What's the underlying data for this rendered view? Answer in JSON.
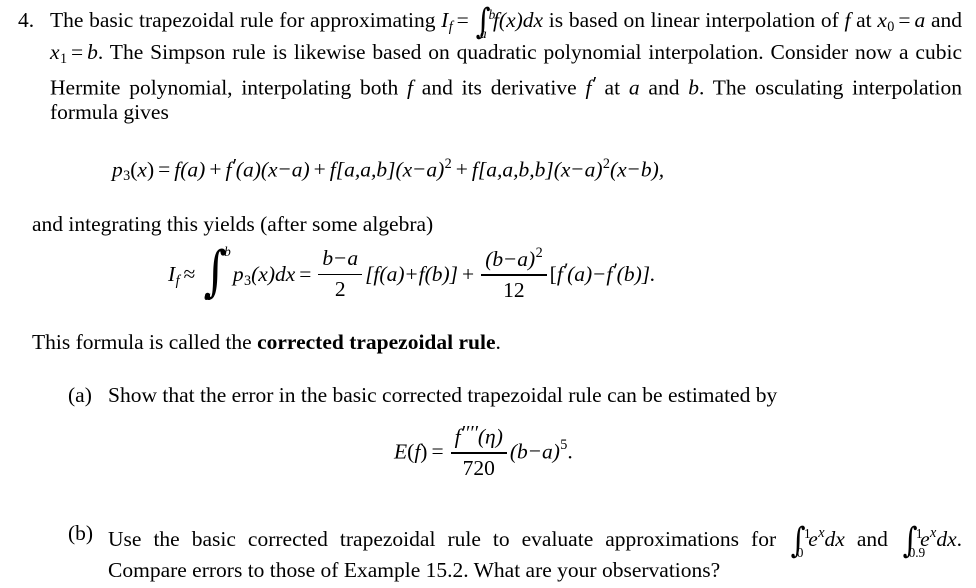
{
  "document": {
    "item_number": "4.",
    "paragraph_1": {
      "t1": "The basic trapezoidal rule for approximating ",
      "sym_I": "I",
      "sym_I_sub": "f",
      "eq": "=",
      "int_lower": "a",
      "int_upper": "b",
      "integrand": "f(x)dx",
      "t2": " is based on linear interpolation of ",
      "sym_f": "f",
      "t3": " at ",
      "x0": "x",
      "x0_sub": "0",
      "eq2": "=",
      "a": "a",
      "t4": " and ",
      "x1": "x",
      "x1_sub": "1",
      "eq3": "=",
      "b": "b",
      "t5": ". The Simpson rule is likewise based on quadratic polynomial interpolation. Consider now a cubic Hermite polynomial, interpolating both ",
      "sym_f2": "f",
      "t6": " and its derivative ",
      "sym_fprime": "f",
      "prime": "′",
      "t7": " at ",
      "a2": "a",
      "t8": " and ",
      "b2": "b",
      "t9": ". The osculating interpolation formula gives"
    },
    "equation_p3": {
      "p": "p",
      "p_sub": "3",
      "open": "(",
      "x": "x",
      "close": ")",
      "eq": "=",
      "f1": "f",
      "arg_a": "(a)",
      "plus1": "+",
      "f2": "f",
      "prime": "′",
      "arg_a2": "(a)(x",
      "minus1": "−",
      "a_close": "a)",
      "plus2": "+",
      "f3": "f",
      "dd1": "[a,a,b](x",
      "minus2": "−",
      "dd1_close": "a)",
      "sup2a": "2",
      "plus3": "+",
      "f4": "f",
      "dd2": "[a,a,b,b](x",
      "minus3": "−",
      "dd2_close": "a)",
      "sup2b": "2",
      "tail_open": "(x",
      "minus4": "−",
      "tail_close": "b),"
    },
    "paragraph_2": "and integrating this yields (after some algebra)",
    "equation_trapezoid": {
      "I": "I",
      "I_sub": "f",
      "approx": "≈",
      "int_lower": "a",
      "int_upper": "b",
      "p3": "p",
      "p3_sub": "3",
      "p3_arg": "(x)dx",
      "eq": "=",
      "frac1_num_b": "b",
      "frac1_num_minus": "−",
      "frac1_num_a": "a",
      "frac1_den": "2",
      "bracket1": "[f(a)",
      "bracket1_plus": "+",
      "bracket1_end": "f(b)]",
      "plus": "+",
      "frac2_num_open": "(b",
      "frac2_num_minus": "−",
      "frac2_num_a": "a)",
      "frac2_num_sup": "2",
      "frac2_den": "12",
      "bracket2_open": "[",
      "bracket2_f1": "f",
      "bracket2_p1": "′",
      "bracket2_a": "(a)",
      "bracket2_minus": "−",
      "bracket2_f2": "f",
      "bracket2_p2": "′",
      "bracket2_b": "(b)]."
    },
    "paragraph_3": {
      "t1": "This formula is called the ",
      "bold": "corrected trapezoidal rule",
      "t2": "."
    },
    "item_a": {
      "label": "(a)",
      "text": "Show that the error in the basic corrected trapezoidal rule can be estimated by"
    },
    "equation_error": {
      "E": "E",
      "E_arg_open": "(",
      "E_arg_f": "f",
      "E_arg_close": ")",
      "eq": "=",
      "num_f": "f",
      "num_primes": "′′′′",
      "num_eta": "(η)",
      "den": "720",
      "tail_open": "(b",
      "tail_minus": "−",
      "tail_a": "a)",
      "tail_sup": "5",
      "tail_period": "."
    },
    "item_b": {
      "label": "(b)",
      "t1": "Use the basic corrected trapezoidal rule to evaluate approximations for ",
      "int1_lower": "0",
      "int1_upper": "1",
      "int1_integrand_e": "e",
      "int1_integrand_sup": "x",
      "int1_integrand_dx": "dx",
      "t2": " and ",
      "int2_lower": "0.9",
      "int2_upper": "1",
      "int2_integrand_e": "e",
      "int2_integrand_sup": "x",
      "int2_integrand_dx": "dx",
      "t3": ". Compare errors to those of Example 15.2. What are your observations?"
    }
  },
  "style": {
    "background_color": "#ffffff",
    "text_color": "#000000"
  }
}
